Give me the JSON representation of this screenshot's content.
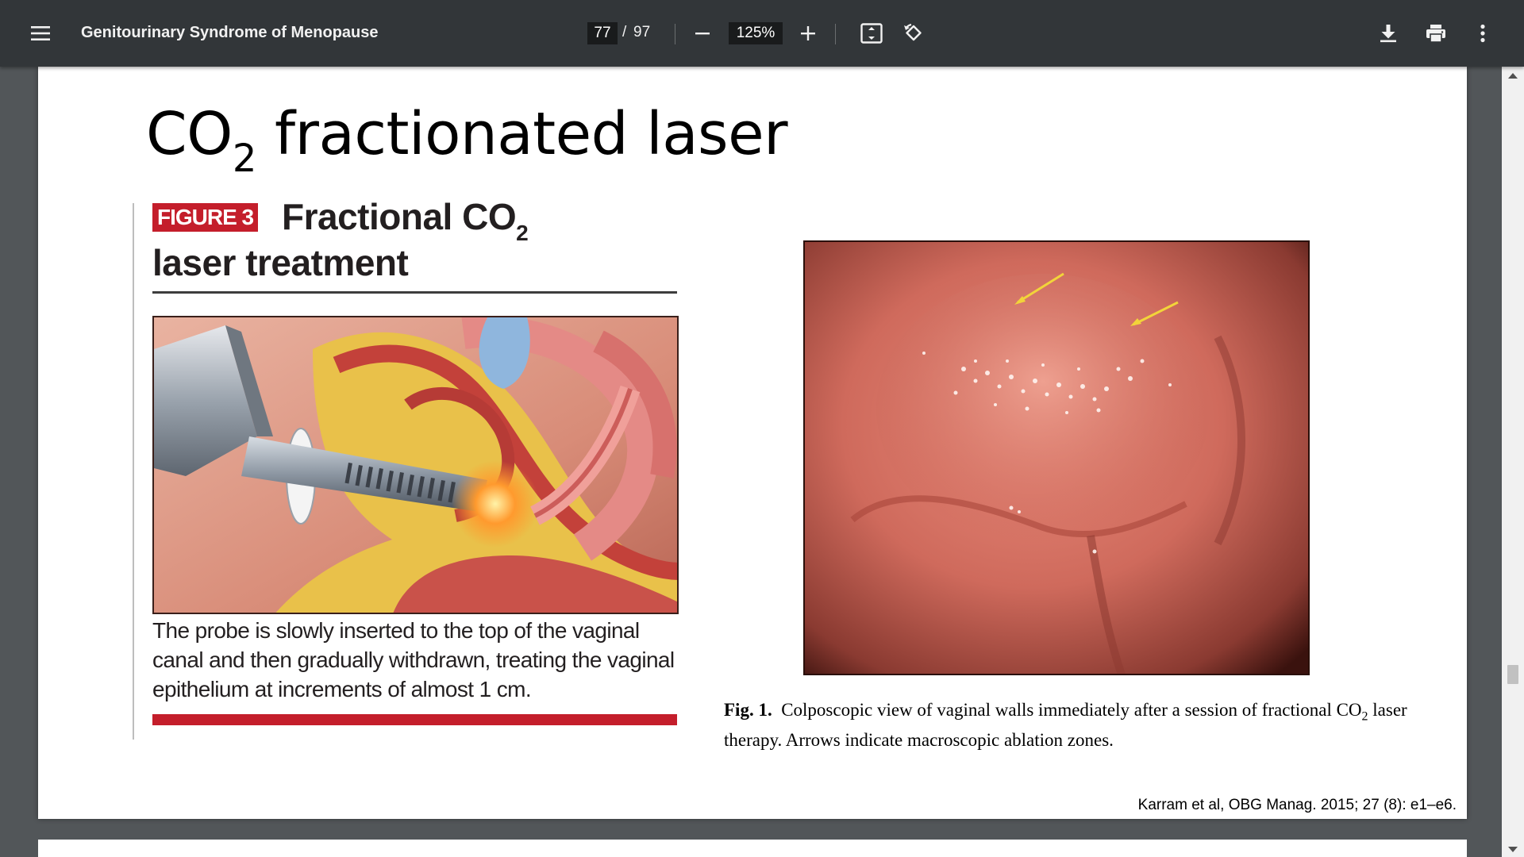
{
  "toolbar": {
    "title": "Genitourinary Syndrome of Menopause",
    "page_current": "77",
    "page_separator": "/",
    "page_total": "97",
    "zoom": "125%"
  },
  "slide": {
    "title_main": "CO",
    "title_sub": "2",
    "title_rest": " fractionated laser",
    "figure3": {
      "badge": "FIGURE 3",
      "heading_line1": "Fractional CO",
      "heading_sub": "2",
      "heading_line2": "laser treatment",
      "caption": "The probe is slowly inserted to the top of the vaginal canal and then gradually withdrawn, treating the vaginal epithelium at increments of almost 1 cm."
    },
    "fig1": {
      "label": "Fig. 1.",
      "caption_a": "Colposcopic view of vaginal walls immediately after a session of fractional CO",
      "caption_sub": "2",
      "caption_b": " laser therapy. Arrows indicate macroscopic ablation zones."
    },
    "citation": "Karram et al, OBG Manag. 2015; 27 (8): e1–e6."
  },
  "colors": {
    "toolbar_bg": "#323639",
    "viewer_bg": "#525659",
    "figure_red": "#c41e2b"
  },
  "icons": [
    "menu-icon",
    "zoom-out-icon",
    "zoom-in-icon",
    "fit-page-icon",
    "rotate-icon",
    "download-icon",
    "print-icon",
    "more-vert-icon"
  ]
}
